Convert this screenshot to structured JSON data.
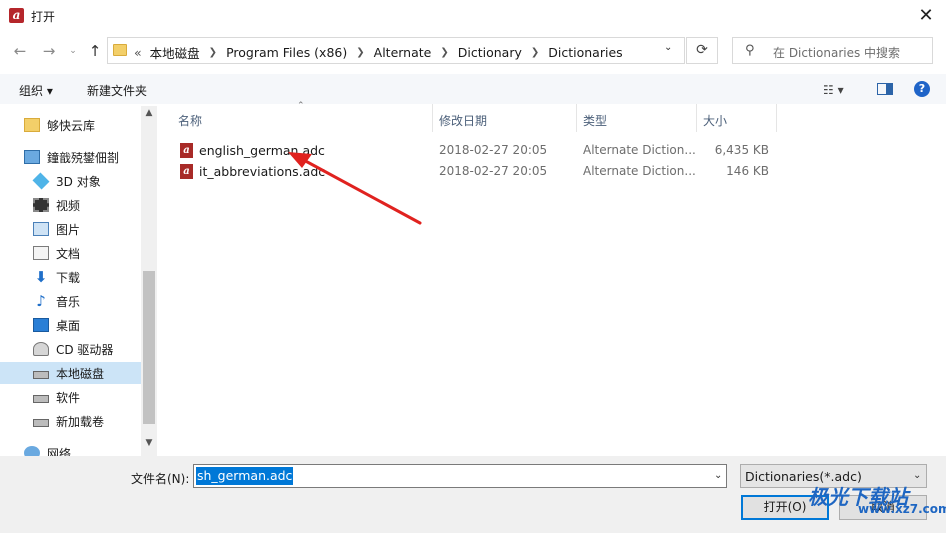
{
  "window": {
    "title": "打开",
    "app_icon": "a"
  },
  "address": {
    "overflow": "«",
    "crumbs": [
      "本地磁盘",
      "Program Files (x86)",
      "Alternate",
      "Dictionary",
      "Dictionaries"
    ]
  },
  "search": {
    "placeholder": "在 Dictionaries 中搜索"
  },
  "toolbar": {
    "organize": "组织 ▾",
    "new_folder": "新建文件夹"
  },
  "nav_pane": {
    "items": [
      {
        "label": "够快云库",
        "icon": "folder-icon"
      },
      {
        "label": "鐘戠殑鐢佃剳",
        "icon": "computer-icon"
      },
      {
        "label": "3D 对象",
        "icon": "3d-objects-icon"
      },
      {
        "label": "视频",
        "icon": "video-icon"
      },
      {
        "label": "图片",
        "icon": "pictures-icon"
      },
      {
        "label": "文档",
        "icon": "documents-icon"
      },
      {
        "label": "下载",
        "icon": "download-icon"
      },
      {
        "label": "音乐",
        "icon": "music-icon"
      },
      {
        "label": "桌面",
        "icon": "desktop-icon"
      },
      {
        "label": "CD 驱动器",
        "icon": "cd-drive-icon"
      },
      {
        "label": "本地磁盘",
        "icon": "local-disk-icon",
        "selected": true
      },
      {
        "label": "软件",
        "icon": "drive-icon"
      },
      {
        "label": "新加载卷",
        "icon": "drive-icon"
      },
      {
        "label": "网络",
        "icon": "network-icon"
      }
    ]
  },
  "file_list": {
    "columns": [
      "名称",
      "修改日期",
      "类型",
      "大小"
    ],
    "rows": [
      {
        "name": "english_german.adc",
        "date": "2018-02-27 20:05",
        "type": "Alternate Diction...",
        "size": "6,435 KB"
      },
      {
        "name": "it_abbreviations.adc",
        "date": "2018-02-27 20:05",
        "type": "Alternate Diction...",
        "size": "146 KB"
      }
    ]
  },
  "bottom": {
    "filename_label": "文件名(N):",
    "filename_value": "sh_german.adc",
    "filter": "Dictionaries(*.adc)",
    "open": "打开(O)",
    "cancel": "取消"
  },
  "watermark": {
    "text": "极光下载站",
    "sub": "www.xz7.com"
  },
  "colors": {
    "accent": "#0078d7",
    "selected_bg": "#cce4f7",
    "annotation_arrow": "#e0221f"
  }
}
